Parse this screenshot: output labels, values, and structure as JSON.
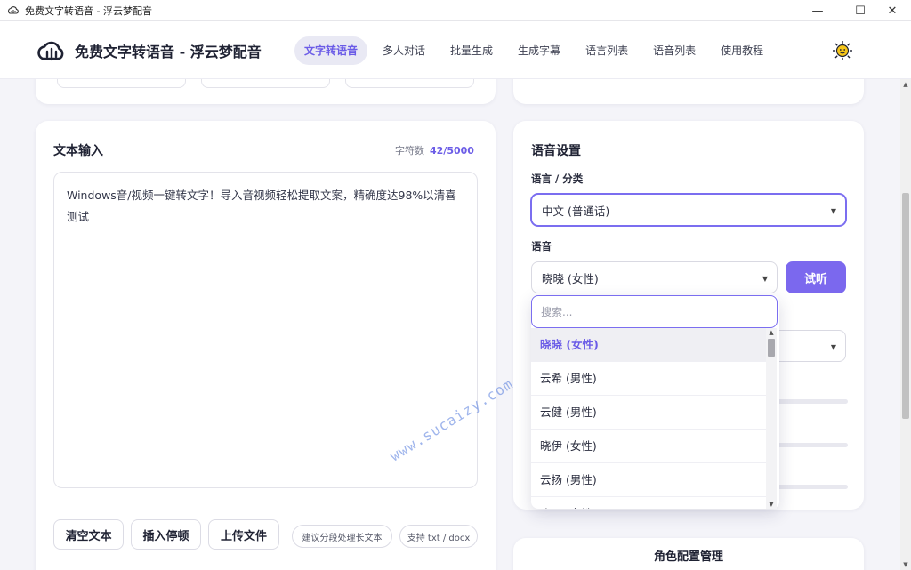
{
  "window": {
    "title": "免费文字转语音 - 浮云梦配音",
    "minimize": "—",
    "maximize": "☐",
    "close": "✕"
  },
  "header": {
    "brand": "免费文字转语音 - 浮云梦配音",
    "nav": [
      {
        "label": "文字转语音",
        "active": true
      },
      {
        "label": "多人对话"
      },
      {
        "label": "批量生成"
      },
      {
        "label": "生成字幕"
      },
      {
        "label": "语言列表"
      },
      {
        "label": "语音列表"
      },
      {
        "label": "使用教程"
      }
    ],
    "theme_icon": "sun-icon"
  },
  "text_input": {
    "title": "文本输入",
    "counter_label": "字符数",
    "counter_value": "42/5000",
    "content": "Windows音/视频一键转文字！导入音视频轻松提取文案，精确度达98%以清喜测试",
    "buttons": {
      "clear": "清空文本",
      "pause": "插入停顿",
      "upload": "上传文件"
    },
    "chips": {
      "split": "建议分段处理长文本",
      "formats": "支持 txt / docx"
    }
  },
  "voice_settings": {
    "title": "语音设置",
    "language_label": "语言 / 分类",
    "language_value": "中文 (普通话)",
    "voice_label": "语音",
    "voice_value": "晓晓 (女性)",
    "preview_button": "试听",
    "dropdown": {
      "search_placeholder": "搜索...",
      "options": [
        {
          "label": "晓晓 (女性)",
          "selected": true
        },
        {
          "label": "云希 (男性)"
        },
        {
          "label": "云健 (男性)"
        },
        {
          "label": "晓伊 (女性)"
        },
        {
          "label": "云扬 (男性)"
        },
        {
          "label": "晓辰 (女性)"
        }
      ]
    }
  },
  "role_config": {
    "title": "角色配置管理"
  },
  "watermark": "www.sucaizy.com",
  "colors": {
    "accent": "#7b68ee",
    "accent_text": "#6b5ce7",
    "background": "#f4f4f9"
  }
}
